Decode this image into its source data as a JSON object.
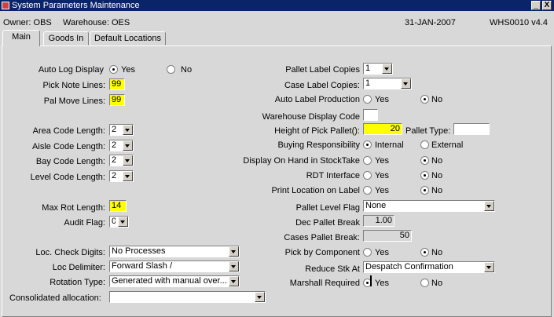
{
  "window": {
    "title": "System Parameters Maintenance",
    "min_label": "_",
    "close_label": "X"
  },
  "header": {
    "owner": "Owner: OBS",
    "warehouse": "Warehouse: OES",
    "date": "31-JAN-2007",
    "module": "WHS0010 v4.4"
  },
  "tabs": [
    {
      "label": "Main"
    },
    {
      "label": "Goods In"
    },
    {
      "label": "Default Locations"
    }
  ],
  "left": {
    "auto_log_display": {
      "label": "Auto Log Display",
      "yes": "Yes",
      "no": "No",
      "selected": "Yes"
    },
    "pick_note_lines": {
      "label": "Pick Note Lines:",
      "value": "99"
    },
    "pal_move_lines": {
      "label": "Pal Move Lines:",
      "value": "99"
    },
    "area_code_length": {
      "label": "Area Code Length:",
      "value": "2"
    },
    "aisle_code_length": {
      "label": "Aisle Code Length:",
      "value": "2"
    },
    "bay_code_length": {
      "label": "Bay Code Length:",
      "value": "2"
    },
    "level_code_length": {
      "label": "Level Code Length:",
      "value": "2"
    },
    "max_rot_length": {
      "label": "Max Rot Length:",
      "value": "14"
    },
    "audit_flag": {
      "label": "Audit Flag:",
      "value": "0"
    },
    "loc_check_digits": {
      "label": "Loc. Check Digits:",
      "value": "No Processes"
    },
    "loc_delimiter": {
      "label": "Loc Delimiter:",
      "value": "Forward Slash /"
    },
    "rotation_type": {
      "label": "Rotation Type:",
      "value": "Generated with manual over..."
    },
    "consolidated_allocation": {
      "label": "Consolidated allocation:",
      "value": ""
    }
  },
  "right": {
    "pallet_label_copies": {
      "label": "Pallet Label Copies",
      "value": "1"
    },
    "case_label_copies": {
      "label": "Case Label Copies:",
      "value": "1"
    },
    "auto_label_production": {
      "label": "Auto Label Production",
      "yes": "Yes",
      "no": "No",
      "selected": "No"
    },
    "warehouse_display_code": {
      "label": "Warehouse Display Code",
      "value": ""
    },
    "height_of_pick_pallet": {
      "label": "Height of Pick Pallet():",
      "value": "20"
    },
    "pallet_type": {
      "label": "Pallet Type:",
      "value": ""
    },
    "buying_responsibility": {
      "label": "Buying Responsibility",
      "internal": "Internal",
      "external": "External",
      "selected": "Internal"
    },
    "display_on_hand": {
      "label": "Display On Hand in StockTake",
      "yes": "Yes",
      "no": "No",
      "selected": "No"
    },
    "rdt_interface": {
      "label": "RDT Interface",
      "yes": "Yes",
      "no": "No",
      "selected": "No"
    },
    "print_location_on_label": {
      "label": "Print Location on Label",
      "yes": "Yes",
      "no": "No",
      "selected": "No"
    },
    "pallet_level_flag": {
      "label": "Pallet Level Flag",
      "value": "None"
    },
    "dec_pallet_break": {
      "label": "Dec Pallet Break",
      "value": "1.00"
    },
    "cases_pallet_break": {
      "label": "Cases Pallet Break:",
      "value": "50"
    },
    "pick_by_component": {
      "label": "Pick by Component",
      "yes": "Yes",
      "no": "No",
      "selected": "No"
    },
    "reduce_stk_at": {
      "label": "Reduce Stk At",
      "value": "Despatch Confirmation"
    },
    "marshall_required": {
      "label": "Marshall Required",
      "yes": "Yes",
      "no": "No",
      "selected": "Yes"
    }
  },
  "colors": {
    "title_bar": "#0a246a",
    "panel": "#d8d8d8",
    "required_field": "#ffff00"
  }
}
